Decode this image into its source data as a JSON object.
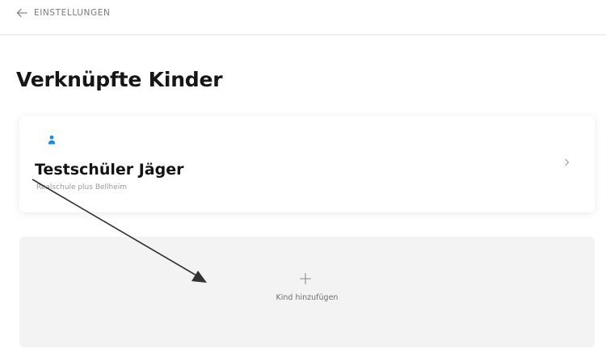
{
  "header": {
    "back_label": "EINSTELLUNGEN",
    "back_icon": "arrow-left-icon"
  },
  "page": {
    "title": "Verknüpfte Kinder"
  },
  "children": [
    {
      "name": "Testschüler Jäger",
      "school": "Realschule plus Bellheim",
      "icon": "person-icon",
      "icon_color": "#1e88e5"
    }
  ],
  "add_child": {
    "label": "Kind hinzufügen",
    "icon": "plus-icon"
  },
  "colors": {
    "accent": "#1e88e5",
    "tile_background": "#f3f3f3",
    "annotation": "#333333"
  }
}
